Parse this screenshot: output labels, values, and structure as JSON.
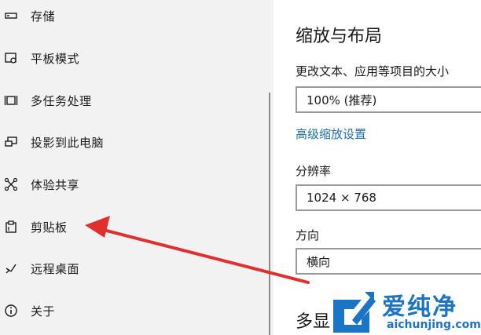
{
  "sidebar": {
    "items": [
      {
        "label": "存储",
        "icon": "storage-icon"
      },
      {
        "label": "平板模式",
        "icon": "tablet-mode-icon"
      },
      {
        "label": "多任务处理",
        "icon": "multitasking-icon"
      },
      {
        "label": "投影到此电脑",
        "icon": "project-to-pc-icon"
      },
      {
        "label": "体验共享",
        "icon": "shared-experiences-icon"
      },
      {
        "label": "剪贴板",
        "icon": "clipboard-icon"
      },
      {
        "label": "远程桌面",
        "icon": "remote-desktop-icon"
      },
      {
        "label": "关于",
        "icon": "info-icon"
      }
    ]
  },
  "main": {
    "title": "缩放与布局",
    "scale_label": "更改文本、应用等项目的大小",
    "scale_value": "100% (推荐)",
    "advanced_link": "高级缩放设置",
    "resolution_label": "分辨率",
    "resolution_value": "1024 × 768",
    "orientation_label": "方向",
    "orientation_value": "横向",
    "section2_title": "多显"
  },
  "watermark": {
    "brand": "爱纯净",
    "url": "aichunjing.com"
  },
  "colors": {
    "sidebar_bg": "#f2f2f2",
    "link": "#1d6fa8",
    "arrow": "#e02f2f",
    "watermark": "#1b74c4"
  }
}
